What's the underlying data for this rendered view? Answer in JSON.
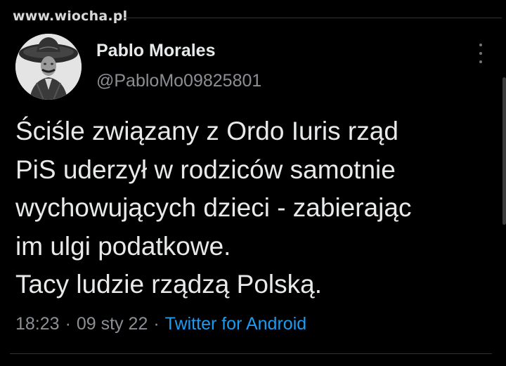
{
  "watermark": "www.wiocha.pl",
  "author": {
    "name": "Pablo Morales",
    "handle": "@PabloMo09825801"
  },
  "tweet": {
    "lines": [
      "Ściśle związany z Ordo Iuris rząd",
      "PiS uderzył w rodziców samotnie",
      "wychowujących dzieci - zabierając",
      "im ulgi podatkowe.",
      "Tacy ludzie rządzą Polską."
    ]
  },
  "meta": {
    "time": "18:23",
    "date": "09 sty 22",
    "separator": "·",
    "source": "Twitter for Android"
  },
  "colors": {
    "background": "#000000",
    "text": "#e7e9ea",
    "muted": "#8b8f94",
    "link": "#1d9bf0"
  },
  "icons": {
    "more": "more-vertical-icon",
    "avatar": "avatar-sombrero-portrait"
  }
}
